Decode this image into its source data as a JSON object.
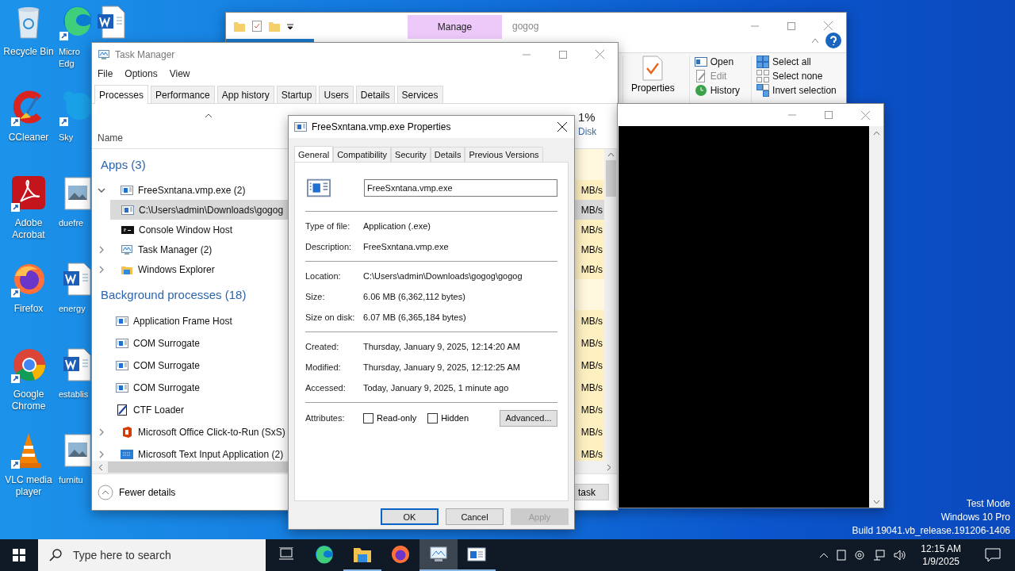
{
  "desktop": {
    "columns": [
      [
        {
          "label": "Recycle Bin",
          "kind": "recycle"
        },
        {
          "label": "CCleaner",
          "kind": "ccleaner"
        },
        {
          "label": "Adobe Acrobat",
          "kind": "acrobat"
        },
        {
          "label": "Firefox",
          "kind": "firefox"
        },
        {
          "label": "Google Chrome",
          "kind": "chrome"
        },
        {
          "label": "VLC media player",
          "kind": "vlc"
        }
      ],
      [
        {
          "label": "Micro Edg",
          "kind": "edge"
        },
        {
          "label": "Sky",
          "kind": "skype"
        },
        {
          "label": "duefre",
          "kind": "image"
        },
        {
          "label": "energy",
          "kind": "word"
        },
        {
          "label": "establis",
          "kind": "word"
        },
        {
          "label": "furnitu",
          "kind": "image"
        }
      ],
      [
        {
          "kind": "word"
        }
      ]
    ],
    "system_overlay": [
      "Test Mode",
      "Windows 10 Pro",
      "Build 19041.vb_release.191206-1406"
    ]
  },
  "explorer": {
    "title": "gogog",
    "context_tab": "Manage",
    "properties": "Properties",
    "open_group": [
      {
        "label": "Open",
        "kind": "open",
        "disabled": false
      },
      {
        "label": "Edit",
        "kind": "edit",
        "disabled": true
      },
      {
        "label": "History",
        "kind": "history",
        "disabled": false
      }
    ],
    "select_group": [
      {
        "label": "Select all",
        "kind": "all"
      },
      {
        "label": "Select none",
        "kind": "none"
      },
      {
        "label": "Invert selection",
        "kind": "invert"
      }
    ]
  },
  "task_manager": {
    "title": "Task Manager",
    "menu": [
      "File",
      "Options",
      "View"
    ],
    "tabs": [
      {
        "label": "Processes",
        "selected": true
      },
      {
        "label": "Performance",
        "selected": false
      },
      {
        "label": "App history",
        "selected": false
      },
      {
        "label": "Startup",
        "selected": false
      },
      {
        "label": "Users",
        "selected": false
      },
      {
        "label": "Details",
        "selected": false
      },
      {
        "label": "Services",
        "selected": false
      }
    ],
    "columns": {
      "name": "Name",
      "disk_percent": "1%",
      "disk": "Disk"
    },
    "groups": [
      {
        "title": "Apps (3)",
        "processes": [
          {
            "name": "FreeSxntana.vmp.exe (2)",
            "kind": "app",
            "expandable": true,
            "expanded": true,
            "selected": false,
            "disk": "MB/s",
            "children": [
              {
                "name": "C:\\Users\\admin\\Downloads\\gogog",
                "kind": "app",
                "expandable": false,
                "selected": true,
                "disk": "MB/s"
              },
              {
                "name": "Console Window Host",
                "kind": "console",
                "expandable": false,
                "selected": false,
                "disk": "MB/s"
              }
            ]
          },
          {
            "name": "Task Manager (2)",
            "kind": "taskmgr",
            "expandable": true,
            "expanded": false,
            "selected": false,
            "disk": "MB/s"
          },
          {
            "name": "Windows Explorer",
            "kind": "explorer",
            "expandable": true,
            "expanded": false,
            "selected": false,
            "disk": "MB/s"
          }
        ]
      },
      {
        "title": "Background processes (18)",
        "processes": [
          {
            "name": "Application Frame Host",
            "kind": "app",
            "expandable": false,
            "selected": false,
            "disk": "MB/s"
          },
          {
            "name": "COM Surrogate",
            "kind": "app",
            "expandable": false,
            "selected": false,
            "disk": "MB/s"
          },
          {
            "name": "COM Surrogate",
            "kind": "app",
            "expandable": false,
            "selected": false,
            "disk": "MB/s"
          },
          {
            "name": "COM Surrogate",
            "kind": "app",
            "expandable": false,
            "selected": false,
            "disk": "MB/s"
          },
          {
            "name": "CTF Loader",
            "kind": "ctf",
            "expandable": false,
            "selected": false,
            "disk": "MB/s"
          },
          {
            "name": "Microsoft Office Click-to-Run (SxS)",
            "kind": "office",
            "expandable": true,
            "expanded": false,
            "selected": false,
            "disk": "MB/s"
          },
          {
            "name": "Microsoft Text Input Application (2)",
            "kind": "textinput",
            "expandable": true,
            "expanded": false,
            "selected": false,
            "disk": "MB/s"
          }
        ]
      }
    ],
    "footer": {
      "fewer_details": "Fewer details",
      "end_task": "task"
    }
  },
  "properties": {
    "title": "FreeSxntana.vmp.exe Properties",
    "tabs": [
      {
        "label": "General",
        "selected": true
      },
      {
        "label": "Compatibility",
        "selected": false
      },
      {
        "label": "Security",
        "selected": false
      },
      {
        "label": "Details",
        "selected": false
      },
      {
        "label": "Previous Versions",
        "selected": false
      }
    ],
    "file_name": "FreeSxntana.vmp.exe",
    "sections": [
      [
        {
          "label": "Type of file:",
          "value": "Application (.exe)"
        },
        {
          "label": "Description:",
          "value": "FreeSxntana.vmp.exe"
        }
      ],
      [
        {
          "label": "Location:",
          "value": "C:\\Users\\admin\\Downloads\\gogog\\gogog"
        },
        {
          "label": "Size:",
          "value": "6.06 MB (6,362,112 bytes)"
        },
        {
          "label": "Size on disk:",
          "value": "6.07 MB (6,365,184 bytes)"
        }
      ],
      [
        {
          "label": "Created:",
          "value": "Thursday, January 9, 2025, 12:14:20 AM"
        },
        {
          "label": "Modified:",
          "value": "Thursday, January 9, 2025, 12:12:25 AM"
        },
        {
          "label": "Accessed:",
          "value": "Today, January 9, 2025, 1 minute ago"
        }
      ]
    ],
    "attributes": {
      "label": "Attributes:",
      "checkboxes": [
        {
          "label": "Read-only",
          "checked": false
        },
        {
          "label": "Hidden",
          "checked": false
        }
      ],
      "advanced": "Advanced..."
    },
    "buttons": [
      {
        "label": "OK",
        "default": true,
        "disabled": false
      },
      {
        "label": "Cancel",
        "default": false,
        "disabled": false
      },
      {
        "label": "Apply",
        "default": false,
        "disabled": true
      }
    ]
  },
  "taskbar": {
    "search_placeholder": "Type here to search",
    "apps": [
      {
        "kind": "taskview",
        "running": false,
        "selected": false
      },
      {
        "kind": "edge",
        "running": false,
        "selected": false
      },
      {
        "kind": "explorer",
        "running": true,
        "selected": false
      },
      {
        "kind": "firefox",
        "running": false,
        "selected": false
      },
      {
        "kind": "taskmgr",
        "running": true,
        "selected": true
      },
      {
        "kind": "app",
        "running": true,
        "selected": false
      }
    ],
    "time": "12:15 AM",
    "date": "1/9/2025"
  }
}
